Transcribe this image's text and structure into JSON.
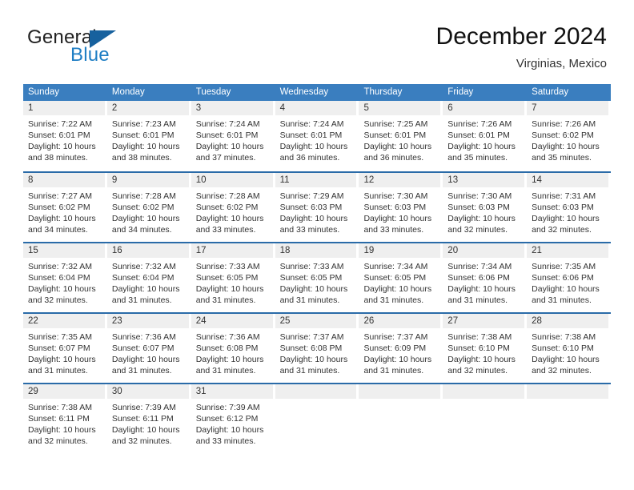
{
  "brand": {
    "word_one": "General",
    "word_two": "Blue",
    "mark": "triangle-logo"
  },
  "title": {
    "month_year": "December 2024",
    "location": "Virginias, Mexico"
  },
  "weekdays": [
    "Sunday",
    "Monday",
    "Tuesday",
    "Wednesday",
    "Thursday",
    "Friday",
    "Saturday"
  ],
  "colors": {
    "header_blue": "#3a7ebf",
    "separator_blue": "#2a6ba8",
    "day_band_gray": "#efefef",
    "brand_blue": "#1f7ec4",
    "mark_blue": "#17619e"
  },
  "weeks": [
    [
      {
        "day": "1",
        "sunrise": "Sunrise: 7:22 AM",
        "sunset": "Sunset: 6:01 PM",
        "daylight_1": "Daylight: 10 hours",
        "daylight_2": "and 38 minutes."
      },
      {
        "day": "2",
        "sunrise": "Sunrise: 7:23 AM",
        "sunset": "Sunset: 6:01 PM",
        "daylight_1": "Daylight: 10 hours",
        "daylight_2": "and 38 minutes."
      },
      {
        "day": "3",
        "sunrise": "Sunrise: 7:24 AM",
        "sunset": "Sunset: 6:01 PM",
        "daylight_1": "Daylight: 10 hours",
        "daylight_2": "and 37 minutes."
      },
      {
        "day": "4",
        "sunrise": "Sunrise: 7:24 AM",
        "sunset": "Sunset: 6:01 PM",
        "daylight_1": "Daylight: 10 hours",
        "daylight_2": "and 36 minutes."
      },
      {
        "day": "5",
        "sunrise": "Sunrise: 7:25 AM",
        "sunset": "Sunset: 6:01 PM",
        "daylight_1": "Daylight: 10 hours",
        "daylight_2": "and 36 minutes."
      },
      {
        "day": "6",
        "sunrise": "Sunrise: 7:26 AM",
        "sunset": "Sunset: 6:01 PM",
        "daylight_1": "Daylight: 10 hours",
        "daylight_2": "and 35 minutes."
      },
      {
        "day": "7",
        "sunrise": "Sunrise: 7:26 AM",
        "sunset": "Sunset: 6:02 PM",
        "daylight_1": "Daylight: 10 hours",
        "daylight_2": "and 35 minutes."
      }
    ],
    [
      {
        "day": "8",
        "sunrise": "Sunrise: 7:27 AM",
        "sunset": "Sunset: 6:02 PM",
        "daylight_1": "Daylight: 10 hours",
        "daylight_2": "and 34 minutes."
      },
      {
        "day": "9",
        "sunrise": "Sunrise: 7:28 AM",
        "sunset": "Sunset: 6:02 PM",
        "daylight_1": "Daylight: 10 hours",
        "daylight_2": "and 34 minutes."
      },
      {
        "day": "10",
        "sunrise": "Sunrise: 7:28 AM",
        "sunset": "Sunset: 6:02 PM",
        "daylight_1": "Daylight: 10 hours",
        "daylight_2": "and 33 minutes."
      },
      {
        "day": "11",
        "sunrise": "Sunrise: 7:29 AM",
        "sunset": "Sunset: 6:03 PM",
        "daylight_1": "Daylight: 10 hours",
        "daylight_2": "and 33 minutes."
      },
      {
        "day": "12",
        "sunrise": "Sunrise: 7:30 AM",
        "sunset": "Sunset: 6:03 PM",
        "daylight_1": "Daylight: 10 hours",
        "daylight_2": "and 33 minutes."
      },
      {
        "day": "13",
        "sunrise": "Sunrise: 7:30 AM",
        "sunset": "Sunset: 6:03 PM",
        "daylight_1": "Daylight: 10 hours",
        "daylight_2": "and 32 minutes."
      },
      {
        "day": "14",
        "sunrise": "Sunrise: 7:31 AM",
        "sunset": "Sunset: 6:03 PM",
        "daylight_1": "Daylight: 10 hours",
        "daylight_2": "and 32 minutes."
      }
    ],
    [
      {
        "day": "15",
        "sunrise": "Sunrise: 7:32 AM",
        "sunset": "Sunset: 6:04 PM",
        "daylight_1": "Daylight: 10 hours",
        "daylight_2": "and 32 minutes."
      },
      {
        "day": "16",
        "sunrise": "Sunrise: 7:32 AM",
        "sunset": "Sunset: 6:04 PM",
        "daylight_1": "Daylight: 10 hours",
        "daylight_2": "and 31 minutes."
      },
      {
        "day": "17",
        "sunrise": "Sunrise: 7:33 AM",
        "sunset": "Sunset: 6:05 PM",
        "daylight_1": "Daylight: 10 hours",
        "daylight_2": "and 31 minutes."
      },
      {
        "day": "18",
        "sunrise": "Sunrise: 7:33 AM",
        "sunset": "Sunset: 6:05 PM",
        "daylight_1": "Daylight: 10 hours",
        "daylight_2": "and 31 minutes."
      },
      {
        "day": "19",
        "sunrise": "Sunrise: 7:34 AM",
        "sunset": "Sunset: 6:05 PM",
        "daylight_1": "Daylight: 10 hours",
        "daylight_2": "and 31 minutes."
      },
      {
        "day": "20",
        "sunrise": "Sunrise: 7:34 AM",
        "sunset": "Sunset: 6:06 PM",
        "daylight_1": "Daylight: 10 hours",
        "daylight_2": "and 31 minutes."
      },
      {
        "day": "21",
        "sunrise": "Sunrise: 7:35 AM",
        "sunset": "Sunset: 6:06 PM",
        "daylight_1": "Daylight: 10 hours",
        "daylight_2": "and 31 minutes."
      }
    ],
    [
      {
        "day": "22",
        "sunrise": "Sunrise: 7:35 AM",
        "sunset": "Sunset: 6:07 PM",
        "daylight_1": "Daylight: 10 hours",
        "daylight_2": "and 31 minutes."
      },
      {
        "day": "23",
        "sunrise": "Sunrise: 7:36 AM",
        "sunset": "Sunset: 6:07 PM",
        "daylight_1": "Daylight: 10 hours",
        "daylight_2": "and 31 minutes."
      },
      {
        "day": "24",
        "sunrise": "Sunrise: 7:36 AM",
        "sunset": "Sunset: 6:08 PM",
        "daylight_1": "Daylight: 10 hours",
        "daylight_2": "and 31 minutes."
      },
      {
        "day": "25",
        "sunrise": "Sunrise: 7:37 AM",
        "sunset": "Sunset: 6:08 PM",
        "daylight_1": "Daylight: 10 hours",
        "daylight_2": "and 31 minutes."
      },
      {
        "day": "26",
        "sunrise": "Sunrise: 7:37 AM",
        "sunset": "Sunset: 6:09 PM",
        "daylight_1": "Daylight: 10 hours",
        "daylight_2": "and 31 minutes."
      },
      {
        "day": "27",
        "sunrise": "Sunrise: 7:38 AM",
        "sunset": "Sunset: 6:10 PM",
        "daylight_1": "Daylight: 10 hours",
        "daylight_2": "and 32 minutes."
      },
      {
        "day": "28",
        "sunrise": "Sunrise: 7:38 AM",
        "sunset": "Sunset: 6:10 PM",
        "daylight_1": "Daylight: 10 hours",
        "daylight_2": "and 32 minutes."
      }
    ],
    [
      {
        "day": "29",
        "sunrise": "Sunrise: 7:38 AM",
        "sunset": "Sunset: 6:11 PM",
        "daylight_1": "Daylight: 10 hours",
        "daylight_2": "and 32 minutes."
      },
      {
        "day": "30",
        "sunrise": "Sunrise: 7:39 AM",
        "sunset": "Sunset: 6:11 PM",
        "daylight_1": "Daylight: 10 hours",
        "daylight_2": "and 32 minutes."
      },
      {
        "day": "31",
        "sunrise": "Sunrise: 7:39 AM",
        "sunset": "Sunset: 6:12 PM",
        "daylight_1": "Daylight: 10 hours",
        "daylight_2": "and 33 minutes."
      },
      {
        "day": "",
        "sunrise": "",
        "sunset": "",
        "daylight_1": "",
        "daylight_2": ""
      },
      {
        "day": "",
        "sunrise": "",
        "sunset": "",
        "daylight_1": "",
        "daylight_2": ""
      },
      {
        "day": "",
        "sunrise": "",
        "sunset": "",
        "daylight_1": "",
        "daylight_2": ""
      },
      {
        "day": "",
        "sunrise": "",
        "sunset": "",
        "daylight_1": "",
        "daylight_2": ""
      }
    ]
  ]
}
